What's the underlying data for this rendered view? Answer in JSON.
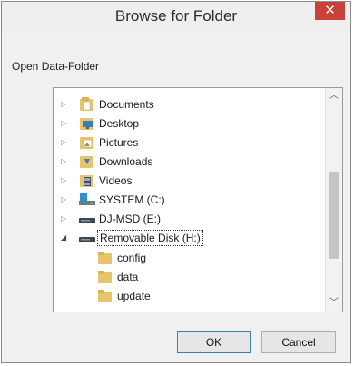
{
  "dialog": {
    "title": "Browse for Folder",
    "close_glyph": "✕",
    "instruction": "Open Data-Folder"
  },
  "tree": {
    "items": [
      {
        "label": "Documents",
        "icon": "documents-folder-icon",
        "expander": "▷"
      },
      {
        "label": "Desktop",
        "icon": "desktop-folder-icon",
        "expander": "▷"
      },
      {
        "label": "Pictures",
        "icon": "pictures-folder-icon",
        "expander": "▷"
      },
      {
        "label": "Downloads",
        "icon": "downloads-folder-icon",
        "expander": "▷"
      },
      {
        "label": "Videos",
        "icon": "videos-folder-icon",
        "expander": "▷"
      },
      {
        "label": "SYSTEM (C:)",
        "icon": "system-drive-icon",
        "expander": "▷"
      },
      {
        "label": "DJ-MSD (E:)",
        "icon": "drive-icon",
        "expander": "▷"
      },
      {
        "label": "Removable Disk (H:)",
        "icon": "removable-disk-icon",
        "expander": "◢",
        "selected": true
      },
      {
        "label": "config",
        "icon": "folder-icon"
      },
      {
        "label": "data",
        "icon": "folder-icon"
      },
      {
        "label": "update",
        "icon": "folder-icon"
      }
    ],
    "scroll_up_glyph": "︿",
    "scroll_down_glyph": "﹀"
  },
  "buttons": {
    "ok_label": "OK",
    "cancel_label": "Cancel"
  },
  "colors": {
    "close_button": "#c8413a",
    "folder": "#e8c46a",
    "scroll_thumb": "#c4c4c4"
  }
}
